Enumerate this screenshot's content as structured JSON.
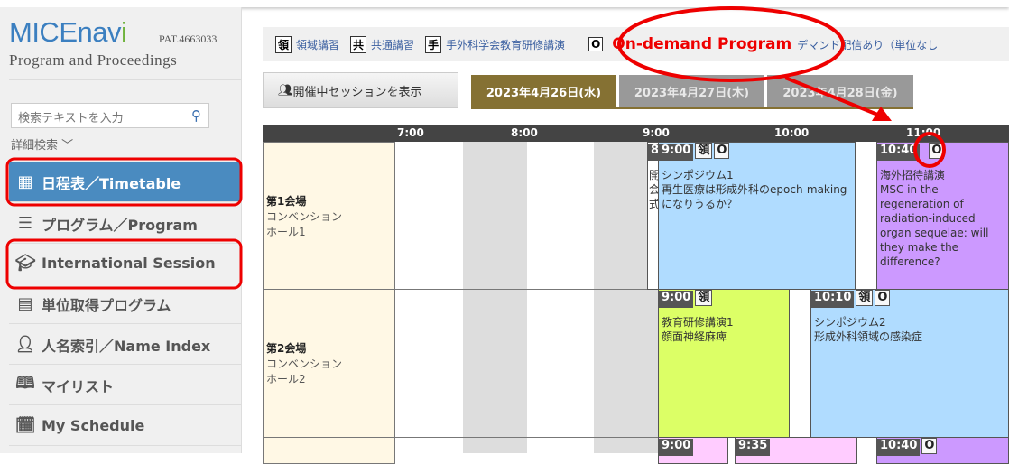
{
  "sidebar": {
    "logo": "MICEnavi",
    "pat": "PAT.4663033",
    "subtitle": "Program and Proceedings",
    "search_placeholder": "検索テキストを入力",
    "advanced_search": "詳細検索",
    "items": [
      {
        "label": "日程表／Timetable",
        "icon": "calendar-grid-icon",
        "active": true
      },
      {
        "label": "プログラム／Program",
        "icon": "list-icon"
      },
      {
        "label": "International Session",
        "icon": "graduation-cap-icon"
      },
      {
        "label": "単位取得プログラム",
        "icon": "certificate-icon"
      },
      {
        "label": "人名索引／Name Index",
        "icon": "person-icon"
      },
      {
        "label": "マイリスト",
        "icon": "book-icon"
      },
      {
        "label": "My Schedule",
        "icon": "calendar-icon"
      }
    ]
  },
  "legend": [
    {
      "badge": "領",
      "label": "領域講習"
    },
    {
      "badge": "共",
      "label": "共通講習"
    },
    {
      "badge": "手",
      "label": "手外科学会教育研修講演"
    },
    {
      "badge": "O",
      "label": "デマンド配信あり（単位なし"
    }
  ],
  "annotation": {
    "ondemand": "On-demand Program",
    "color": "#e00000"
  },
  "show_button": "開催中セッションを表示",
  "tabs": [
    "2023年4月26日(水)",
    "2023年4月27日(木)",
    "2023年4月28日(金)"
  ],
  "hours": [
    "7:00",
    "8:00",
    "9:00",
    "10:00",
    "11:00"
  ],
  "rooms": [
    {
      "name": "第1会場",
      "sub1": "コンベンション",
      "sub2": "ホール1"
    },
    {
      "name": "第2会場",
      "sub1": "コンベンション",
      "sub2": "ホール2"
    }
  ],
  "events": {
    "r1a": {
      "time": "8",
      "text": "開会式"
    },
    "r1b": {
      "time": "9:00",
      "badges": [
        "領",
        "O"
      ],
      "title": "シンポジウム1",
      "body": "再生医療は形成外科のepoch-makingになりうるか？"
    },
    "r1c": {
      "time": "10:40",
      "badges": [
        "O"
      ],
      "title": "海外招待講演",
      "body": "MSC in the regeneration of radiation-induced organ sequelae: will they make the difference?"
    },
    "r2a": {
      "time": "9:00",
      "badges": [
        "領"
      ],
      "title": "教育研修講演1",
      "body": "顔面神経麻痺"
    },
    "r2b": {
      "time": "10:10",
      "badges": [
        "領",
        "O"
      ],
      "title": "シンポジウム2",
      "body": "形成外科領域の感染症"
    },
    "r3a": {
      "time": "9:00"
    },
    "r3b": {
      "time": "9:35"
    },
    "r3c": {
      "time": "10:40",
      "badges": [
        "O"
      ]
    }
  },
  "colors": {
    "active_nav": "#4a8bc0",
    "active_tab": "#857133",
    "symposium": "#b0dcff",
    "invited": "#cc99ff",
    "education": "#dcff66",
    "pink": "#ffccff"
  }
}
